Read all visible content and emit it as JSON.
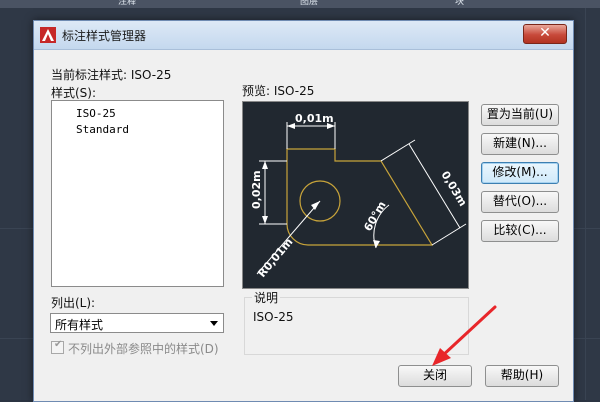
{
  "background": {
    "top_labels": [
      "注释",
      "图层",
      "块"
    ],
    "colors": {
      "cad_bg": "#2f3846",
      "dialog_bg": "#f0f0f0"
    }
  },
  "dialog": {
    "title": "标注样式管理器",
    "close_glyph": "✕",
    "current_style_label": "当前标注样式:",
    "current_style_value": "ISO-25",
    "styles_label": "样式(S):",
    "styles": [
      "ISO-25",
      "Standard"
    ],
    "preview_label": "预览: ISO-25",
    "list_label": "列出(L):",
    "list_selected": "所有样式",
    "checkbox_label": "不列出外部参照中的样式(D)",
    "checkbox_checked": true,
    "description_label": "说明",
    "description_value": "ISO-25",
    "buttons": {
      "set_current": "置为当前(U)",
      "new": "新建(N)...",
      "modify": "修改(M)...",
      "override": "替代(O)...",
      "compare": "比较(C)...",
      "close": "关闭",
      "help": "帮助(H)"
    }
  },
  "preview_drawing": {
    "dim_top": "0,01m",
    "dim_left": "0,02m",
    "dim_diag": "0,03m",
    "dim_angle": "60°m",
    "dim_radius": "R0,01m",
    "colors": {
      "shape": "#c8a43a",
      "dims": "#ffffff",
      "bg": "#212830"
    }
  },
  "annotation": {
    "arrow_color": "#e8262a"
  }
}
